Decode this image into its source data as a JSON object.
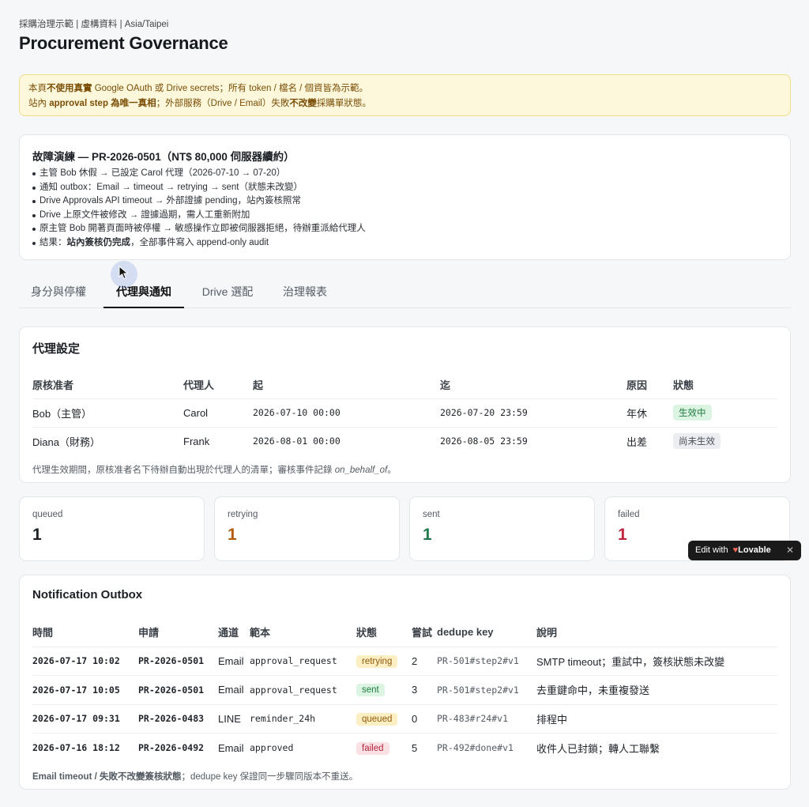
{
  "header": {
    "meta": "採購治理示範 | 虛構資料 | Asia/Taipei",
    "title": "Procurement Governance"
  },
  "warning": {
    "l1_a": "本頁",
    "l1_b": "不使用真實",
    "l1_c": " Google OAuth 或 Drive secrets；所有 token / 檔名 / 個資皆為示範。",
    "l2_a": "站內 ",
    "l2_b": "approval step 為唯一真相",
    "l2_c": "；外部服務（Drive / Email）失敗",
    "l2_d": "不改變",
    "l2_e": "採購單狀態。"
  },
  "drill": {
    "title": "故障演練 — PR-2026-0501（NT$ 80,000 伺服器續約）",
    "items": [
      "主管 Bob 休假 → 已設定 Carol 代理（2026-07-10 → 07-20）",
      "通知 outbox：Email → timeout → retrying → sent（狀態未改變）",
      "Drive Approvals API timeout → 外部證據 pending，站內簽核照常",
      "Drive 上原文件被修改 → 證據過期，需人工重新附加",
      "原主管 Bob 開著頁面時被停權 → 敏感操作立即被伺服器拒絕，待辦重派給代理人"
    ],
    "result_prefix": "結果：",
    "result_bold": "站內簽核仍完成",
    "result_suffix": "，全部事件寫入 append-only audit"
  },
  "tabs": [
    "身分與停權",
    "代理與通知",
    "Drive 選配",
    "治理報表"
  ],
  "active_tab": 1,
  "proxy": {
    "title": "代理設定",
    "headers": [
      "原核准者",
      "代理人",
      "起",
      "迄",
      "原因",
      "狀態"
    ],
    "rows": [
      {
        "approver": "Bob（主管）",
        "delegate": "Carol",
        "from": "2026-07-10 00:00",
        "to": "2026-07-20 23:59",
        "reason": "年休",
        "status": "生效中"
      },
      {
        "approver": "Diana（財務）",
        "delegate": "Frank",
        "from": "2026-08-01 00:00",
        "to": "2026-08-05 23:59",
        "reason": "出差",
        "status": "尚未生效"
      }
    ],
    "note_text": "代理生效期間，原核准者名下待辦自動出現於代理人的清單；審核事件記錄 ",
    "note_italic": "on_behalf_of",
    "note_end": "。"
  },
  "stats": [
    {
      "label": "queued",
      "value": "1",
      "color": "#1c1f24"
    },
    {
      "label": "retrying",
      "value": "1",
      "color": "#b35c0a"
    },
    {
      "label": "sent",
      "value": "1",
      "color": "#217a4d"
    },
    {
      "label": "failed",
      "value": "1",
      "color": "#c0263f"
    }
  ],
  "outbox": {
    "title": "Notification Outbox",
    "headers": [
      "時間",
      "申請",
      "通道",
      "範本",
      "狀態",
      "嘗試",
      "dedupe key",
      "說明"
    ],
    "rows": [
      {
        "time": "2026-07-17 10:02",
        "request": "PR-2026-0501",
        "channel": "Email",
        "template": "approval_request",
        "status": "retrying",
        "attempts": "2",
        "dedupe": "PR-501#step2#v1",
        "desc": "SMTP timeout；重試中，簽核狀態未改變"
      },
      {
        "time": "2026-07-17 10:05",
        "request": "PR-2026-0501",
        "channel": "Email",
        "template": "approval_request",
        "status": "sent",
        "attempts": "3",
        "dedupe": "PR-501#step2#v1",
        "desc": "去重鍵命中，未重複發送"
      },
      {
        "time": "2026-07-17 09:31",
        "request": "PR-2026-0483",
        "channel": "LINE",
        "template": "reminder_24h",
        "status": "queued",
        "attempts": "0",
        "dedupe": "PR-483#r24#v1",
        "desc": "排程中"
      },
      {
        "time": "2026-07-16 18:12",
        "request": "PR-2026-0492",
        "channel": "Email",
        "template": "approved",
        "status": "failed",
        "attempts": "5",
        "dedupe": "PR-492#done#v1",
        "desc": "收件人已封鎖；轉人工聯繫"
      }
    ],
    "note_bold": "Email timeout / 失敗不改變簽核狀態",
    "note_rest": "；dedupe key 保證同一步驟同版本不重送。"
  },
  "lovable": {
    "text": "Edit with ",
    "brand": "Lovable",
    "close": "✕"
  }
}
